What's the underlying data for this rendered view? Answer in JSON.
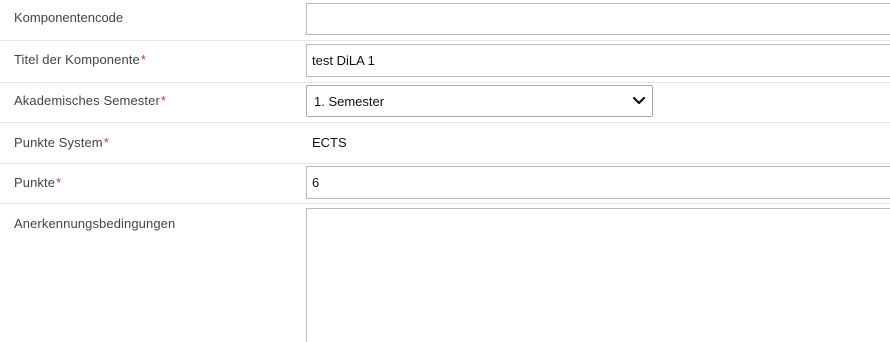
{
  "form": {
    "component_code": {
      "label": "Komponentencode",
      "value": ""
    },
    "component_title": {
      "label": "Titel der Komponente",
      "required_mark": "*",
      "value": "test DiLA 1"
    },
    "academic_semester": {
      "label": "Akademisches Semester",
      "required_mark": "*",
      "selected": "1. Semester"
    },
    "points_system": {
      "label": "Punkte System",
      "required_mark": "*",
      "value": "ECTS"
    },
    "points": {
      "label": "Punkte",
      "required_mark": "*",
      "value": "6"
    },
    "recognition_conditions": {
      "label": "Anerkennungsbedingungen",
      "value": ""
    }
  },
  "colors": {
    "required": "#d9342b",
    "label_text": "#444444",
    "border": "#b9b9b9"
  }
}
